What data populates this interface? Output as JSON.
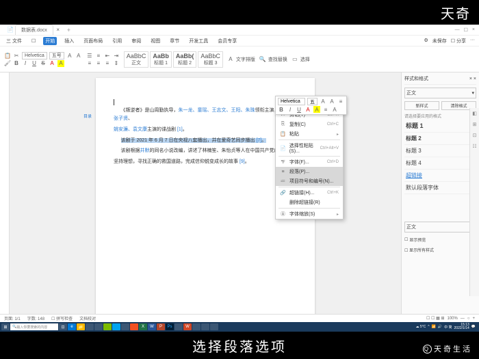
{
  "brand_top": "天奇",
  "caption": "选择段落选项",
  "watermark": "天奇生活",
  "titlebar": {
    "doc_tab": "数据表.docx",
    "close": "×",
    "min": "—",
    "max": "☐"
  },
  "menubar": {
    "items": [
      "三 文件",
      "☐",
      "开始",
      "插入",
      "页面布局",
      "引用",
      "审阅",
      "视图",
      "章节",
      "开发工具",
      "会员专享"
    ],
    "active_index": 2,
    "right": [
      "⚙",
      "未保存",
      "☐ 分享",
      "···"
    ]
  },
  "ribbon": {
    "font_name": "Helvetica",
    "font_size": "五号",
    "bold": "B",
    "italic": "I",
    "underline": "U",
    "strike": "S",
    "style_previews": [
      {
        "sample": "AaBbC",
        "label": "正文"
      },
      {
        "sample": "AaBb",
        "label": "标题 1"
      },
      {
        "sample": "AaBb(",
        "label": "标题 2"
      },
      {
        "sample": "AaBbC",
        "label": "标题 3"
      }
    ],
    "extra": [
      "文字排版",
      "查找替换",
      "选择"
    ]
  },
  "document": {
    "side_label": "目录",
    "p1_a": "《叛逆者》是山周勤执导，",
    "p1_links": "朱一龙、童瑶、王志文、王阳、朱珠",
    "p1_b": "领衔主演，",
    "p1_links2": "李强、张子贤",
    "p1_c": "、",
    "p2_links": "姚安濂、袁文康",
    "p2_a": "主演的谍战剧 ",
    "p2_ref": "[1]",
    "p3_sel": "该剧于 2021 年 6 月 7 日在央视八套播出，并在爱奇艺同步播出 ",
    "p3_ref": "[7]",
    "p4_a": "该剧根据",
    "p4_link": "井默",
    "p4_b": "的同名小说改编，讲述了林楠笙、朱怡贞等人在中国共产党的指引下",
    "p5": "坚持理想，寻找正确的救国道路，完成信仰蜕变成长的故事 ",
    "p5_ref": "[9]",
    "p5_end": "。"
  },
  "mini_toolbar": {
    "font": "Helvetica",
    "size": "五",
    "row2": [
      "B",
      "I",
      "U",
      "A",
      "A",
      "≡",
      "A"
    ]
  },
  "context_menu": {
    "items": [
      {
        "icon": "✂",
        "label": "剪切(T)",
        "shortcut": "Ctrl+X"
      },
      {
        "icon": "⎘",
        "label": "复制(C)",
        "shortcut": "Ctrl+C"
      },
      {
        "icon": "📋",
        "label": "粘贴",
        "arrow": "▸"
      },
      {
        "sep": true
      },
      {
        "icon": "📄",
        "label": "选择性粘贴(S)...",
        "shortcut": "Ctrl+Alt+V"
      },
      {
        "sep": true
      },
      {
        "icon": "℉",
        "label": "字体(F)...",
        "shortcut": "Ctrl+D"
      },
      {
        "icon": "≡",
        "label": "段落(P)...",
        "highlighted": true
      },
      {
        "icon": "≔",
        "label": "项目符号和编号(N)...",
        "highlighted": true
      },
      {
        "sep": true
      },
      {
        "icon": "🔗",
        "label": "超链接(H)...",
        "shortcut": "Ctrl+K"
      },
      {
        "icon": "",
        "label": "删除超链接(R)"
      },
      {
        "sep": true
      },
      {
        "icon": "Ⓐ",
        "label": "字体缩放(S)",
        "arrow": "▸"
      }
    ]
  },
  "side_panel": {
    "title": "样式和格式",
    "current": "正文",
    "btns": [
      "新样式",
      "清除格式"
    ],
    "label": "请选择要应用的格式",
    "styles": [
      {
        "name": "标题 1",
        "cls": "h1",
        "mark": "↲"
      },
      {
        "name": "标题 2",
        "cls": "h2",
        "mark": "↲"
      },
      {
        "name": "标题 3",
        "cls": "",
        "mark": "↲"
      },
      {
        "name": "标题 4",
        "cls": "",
        "mark": "↲"
      },
      {
        "name": "超链接",
        "cls": "",
        "mark": "a",
        "link": true
      },
      {
        "name": "默认段落字体",
        "cls": "",
        "mark": "a"
      }
    ],
    "dropdown": "正文",
    "check1": "显示预览",
    "check2": "☐ 显示所有样式"
  },
  "statusbar": {
    "left": [
      "页面: 1/1",
      "字数: 148",
      "☐ 拼写检查",
      "文档校对"
    ],
    "right": [
      "☐ ☐ ▦ ⊞",
      "100%",
      "—",
      "○",
      "+"
    ]
  },
  "taskbar": {
    "search_placeholder": "输入你要搜索的内容",
    "tray_temp": "☁ 5°C",
    "time": "15:13",
    "date": "2022/1/14"
  }
}
